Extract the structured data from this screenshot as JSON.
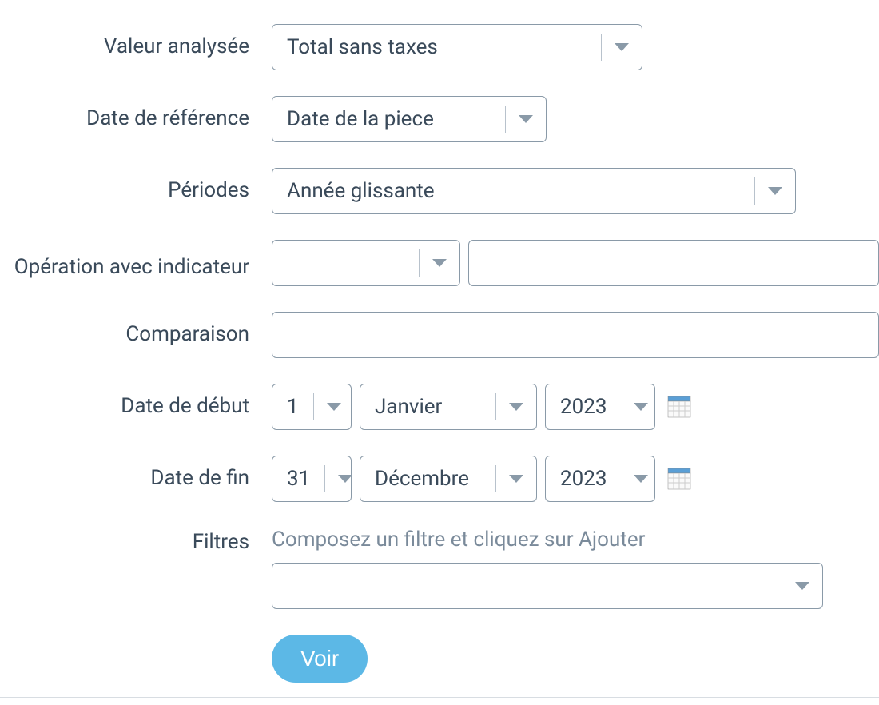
{
  "labels": {
    "valeur_analysee": "Valeur analysée",
    "date_reference": "Date de référence",
    "periodes": "Périodes",
    "operation_indicateur": "Opération avec indicateur",
    "comparaison": "Comparaison",
    "date_debut": "Date de début",
    "date_fin": "Date de fin",
    "filtres": "Filtres"
  },
  "fields": {
    "valeur_analysee": {
      "value": "Total sans taxes"
    },
    "date_reference": {
      "value": "Date de la piece"
    },
    "periodes": {
      "value": "Année glissante"
    },
    "operation_indicateur": {
      "operator": "",
      "indicator": ""
    },
    "comparaison": {
      "value": ""
    },
    "date_debut": {
      "day": "1",
      "month": "Janvier",
      "year": "2023"
    },
    "date_fin": {
      "day": "31",
      "month": "Décembre",
      "year": "2023"
    },
    "filtres": {
      "hint": "Composez un filtre et cliquez sur Ajouter",
      "value": ""
    }
  },
  "buttons": {
    "submit": "Voir"
  }
}
